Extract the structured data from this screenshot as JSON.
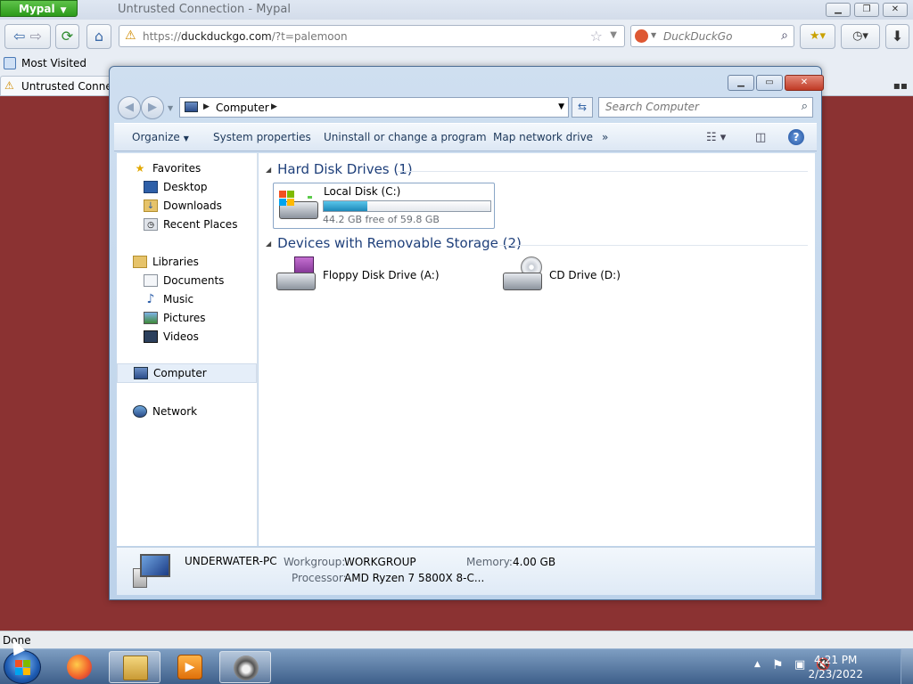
{
  "browser": {
    "app_button": "Mypal",
    "window_title": "Untrusted Connection - Mypal",
    "url_prefix": "https://",
    "url_domain": "duckduckgo.com",
    "url_rest": "/?t=palemoon",
    "search_engine": "DuckDuckGo",
    "bookmark_label": "Most Visited",
    "tab_title": "Untrusted Connection",
    "status": "Done"
  },
  "explorer": {
    "breadcrumb": "Computer",
    "search_placeholder": "Search Computer",
    "commands": {
      "organize": "Organize",
      "system_properties": "System properties",
      "uninstall": "Uninstall or change a program",
      "map_drive": "Map network drive",
      "more": "»"
    },
    "nav": {
      "favorites": "Favorites",
      "desktop": "Desktop",
      "downloads": "Downloads",
      "recent": "Recent Places",
      "libraries": "Libraries",
      "documents": "Documents",
      "music": "Music",
      "pictures": "Pictures",
      "videos": "Videos",
      "computer": "Computer",
      "network": "Network"
    },
    "groups": {
      "hdd": "Hard Disk Drives (1)",
      "removable": "Devices with Removable Storage (2)"
    },
    "drives": {
      "local_name": "Local Disk (C:)",
      "local_free": "44.2 GB free of 59.8 GB",
      "local_used_fraction": 0.26,
      "floppy": "Floppy Disk Drive (A:)",
      "cd": "CD Drive (D:)"
    },
    "details": {
      "pc_name": "UNDERWATER-PC",
      "workgroup_label": "Workgroup:",
      "workgroup": "WORKGROUP",
      "memory_label": "Memory:",
      "memory": "4.00 GB",
      "processor_label": "Processor:",
      "processor": "AMD Ryzen 7 5800X 8-C..."
    }
  },
  "taskbar": {
    "time": "4:21 PM",
    "date": "2/23/2022"
  }
}
